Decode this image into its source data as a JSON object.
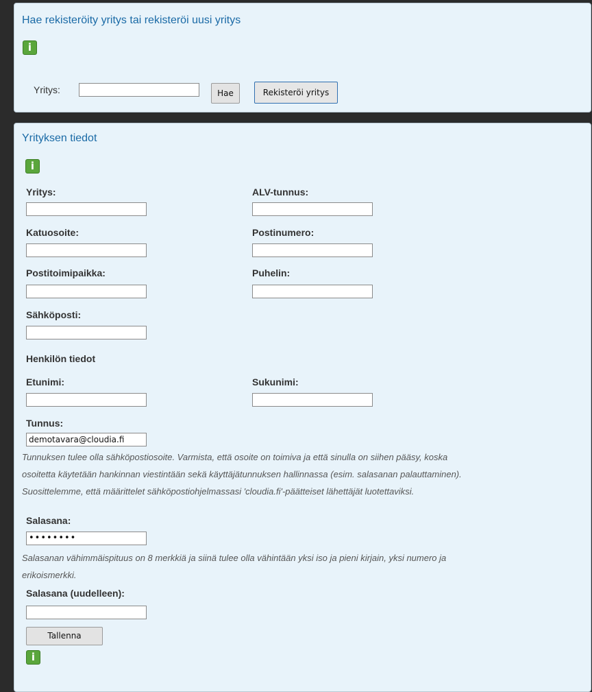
{
  "search_panel": {
    "title": "Hae rekisteröity yritys tai rekisteröi uusi yritys",
    "info_glyph": "i",
    "company_label": "Yritys:",
    "company_value": "",
    "search_button": "Hae",
    "register_button": "Rekisteröi yritys"
  },
  "company_panel": {
    "title": "Yrityksen tiedot",
    "info_glyph": "i",
    "fields": {
      "company": {
        "label": "Yritys:",
        "value": ""
      },
      "vat": {
        "label": "ALV-tunnus:",
        "value": ""
      },
      "street": {
        "label": "Katuosoite:",
        "value": ""
      },
      "postcode": {
        "label": "Postinumero:",
        "value": ""
      },
      "city": {
        "label": "Postitoimipaikka:",
        "value": ""
      },
      "phone": {
        "label": "Puhelin:",
        "value": ""
      },
      "email": {
        "label": "Sähköposti:",
        "value": ""
      }
    },
    "person_heading": "Henkilön tiedot",
    "person": {
      "firstname": {
        "label": "Etunimi:",
        "value": ""
      },
      "lastname": {
        "label": "Sukunimi:",
        "value": ""
      },
      "username": {
        "label": "Tunnus:",
        "value": "demotavara@cloudia.fi"
      },
      "username_hint": [
        "Tunnuksen tulee olla sähköpostiosoite. Varmista, että osoite on toimiva ja että sinulla on siihen pääsy, koska",
        "osoitetta käytetään hankinnan viestintään sekä käyttäjätunnuksen hallinnassa (esim. salasanan palauttaminen).",
        "Suosittelemme, että määrittelet sähköpostiohjelmassasi 'cloudia.fi'-päätteiset lähettäjät luotettaviksi."
      ],
      "password": {
        "label": "Salasana:",
        "value": "••••••••"
      },
      "password_hint": [
        "Salasanan vähimmäispituus on 8 merkkiä ja siinä tulee olla vähintään yksi iso ja pieni kirjain, yksi numero ja",
        "erikoismerkki."
      ],
      "password_repeat": {
        "label": "Salasana (uudelleen):",
        "value": ""
      }
    },
    "save_button": "Tallenna"
  },
  "icons": {
    "info": "info-icon"
  },
  "colors": {
    "panel_bg": "#e8f3fa",
    "title": "#1a6aa6",
    "info_green": "#5aa63c",
    "page_bg": "#2b2b2b"
  }
}
